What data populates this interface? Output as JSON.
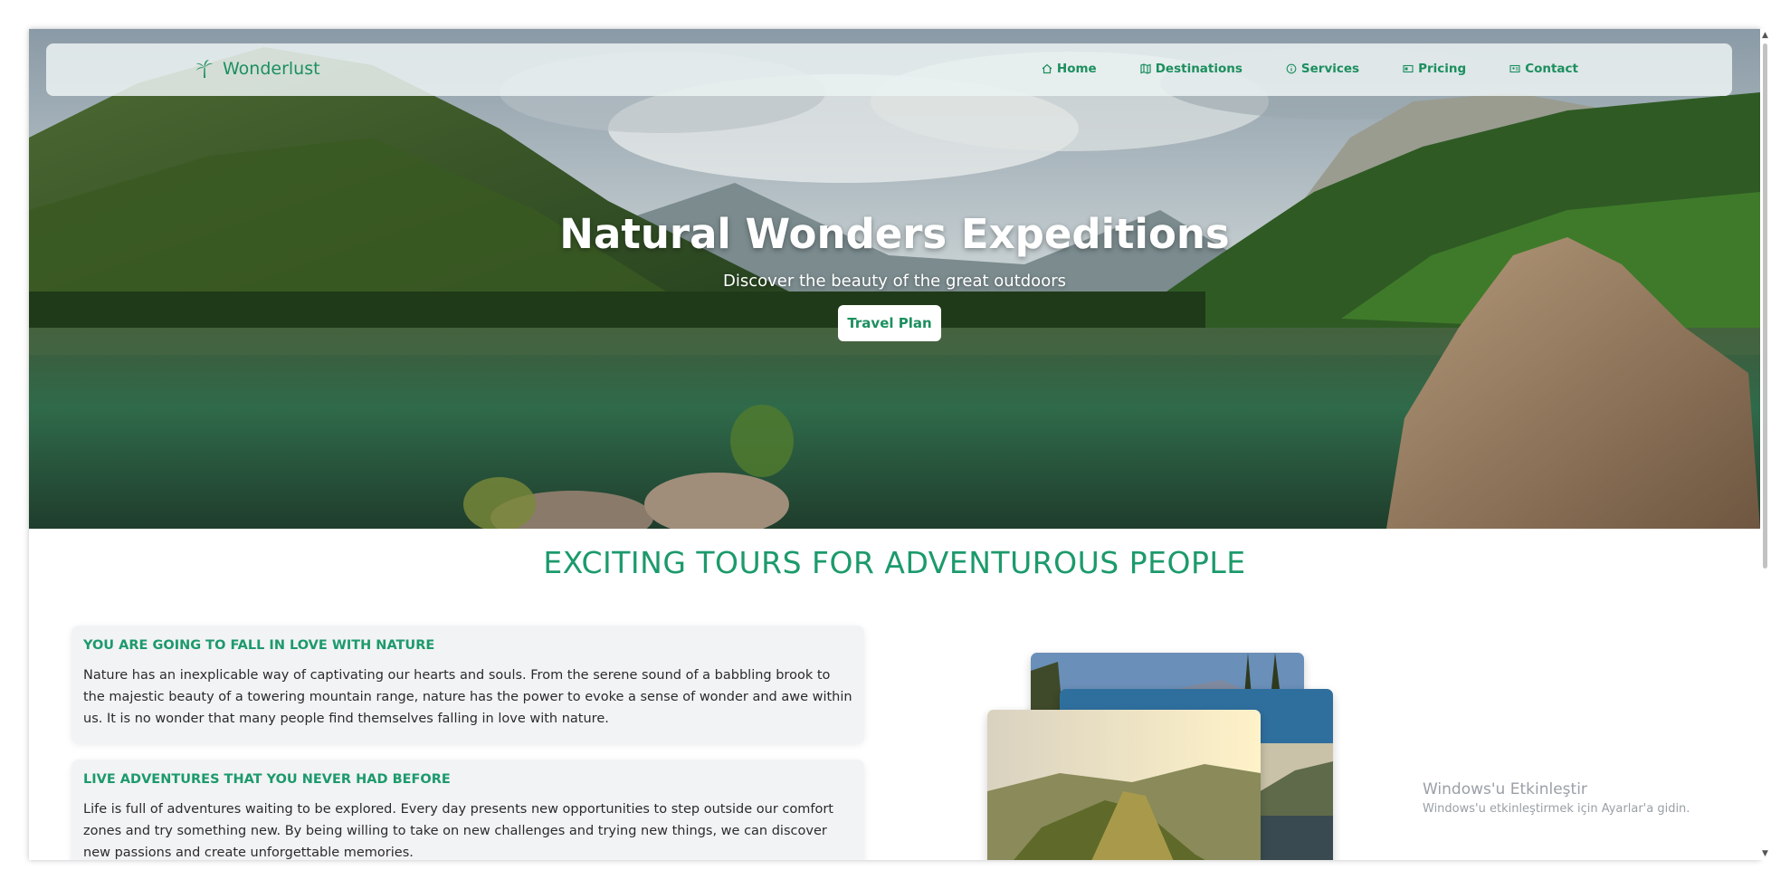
{
  "brand": {
    "name": "Wonderlust",
    "icon": "palm-tree-icon"
  },
  "nav": {
    "items": [
      {
        "label": "Home",
        "icon": "home-icon"
      },
      {
        "label": "Destinations",
        "icon": "map-icon"
      },
      {
        "label": "Services",
        "icon": "info-icon"
      },
      {
        "label": "Pricing",
        "icon": "card-icon"
      },
      {
        "label": "Contact",
        "icon": "contact-icon"
      }
    ]
  },
  "hero": {
    "title": "Natural Wonders Expeditions",
    "subtitle": "Discover the beauty of the great outdoors",
    "button": "Travel Plan"
  },
  "section": {
    "title": "EXCITING TOURS FOR ADVENTUROUS PEOPLE"
  },
  "cards": [
    {
      "title": "YOU ARE GOING TO FALL IN LOVE WITH NATURE",
      "text": "Nature has an inexplicable way of captivating our hearts and souls. From the serene sound of a babbling brook to the majestic beauty of a towering mountain range, nature has the power to evoke a sense of wonder and awe within us. It is no wonder that many people find themselves falling in love with nature."
    },
    {
      "title": "LIVE ADVENTURES THAT YOU NEVER HAD BEFORE",
      "text": "Life is full of adventures waiting to be explored. Every day presents new opportunities to step outside our comfort zones and try something new. By being willing to take on new challenges and trying new things, we can discover new passions and create unforgettable memories."
    }
  ],
  "watermark": {
    "line1": "Windows'u Etkinleştir",
    "line2": "Windows'u etkinleştirmek için Ayarlar'a gidin."
  },
  "colors": {
    "accent": "#1c9a6b",
    "card_bg": "#f2f3f5"
  }
}
